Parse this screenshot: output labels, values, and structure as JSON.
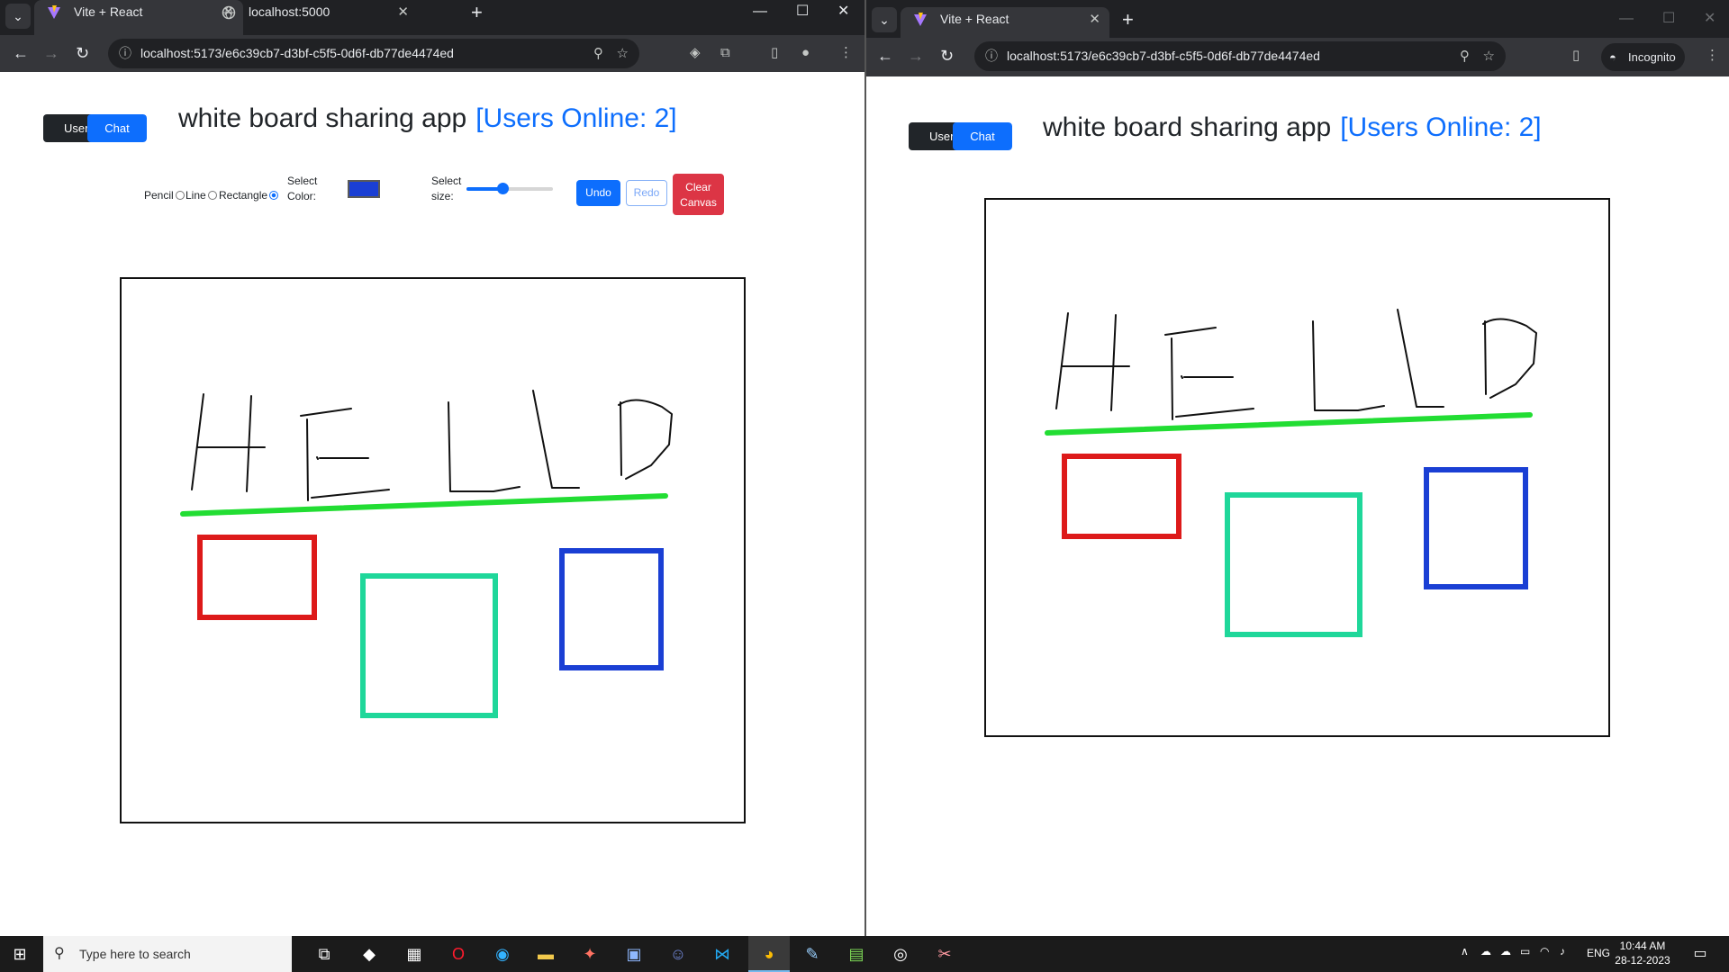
{
  "left_window": {
    "tabs": [
      {
        "title": "Vite + React",
        "active": true
      },
      {
        "title": "localhost:5000",
        "active": false
      }
    ],
    "url": "localhost:5173/e6c39cb7-d3bf-c5f5-0d6f-db77de4474ed",
    "toggle": {
      "user_label": "User",
      "chat_label": "Chat"
    },
    "title": "white board sharing app",
    "users_online": "[Users Online: 2]",
    "tools": {
      "pencil_label": "Pencil",
      "line_label": "Line",
      "rectangle_label": "Rectangle",
      "selected_tool": "rectangle",
      "color_label_1": "Select",
      "color_label_2": "Color:",
      "color_value": "#1a3fd4",
      "size_label_1": "Select",
      "size_label_2": "size:",
      "size_fraction": 0.42,
      "undo_label": "Undo",
      "redo_label": "Redo",
      "clear_label_1": "Clear",
      "clear_label_2": "Canvas"
    }
  },
  "right_window": {
    "tabs": [
      {
        "title": "Vite + React",
        "active": true
      }
    ],
    "url": "localhost:5173/e6c39cb7-d3bf-c5f5-0d6f-db77de4474ed",
    "incognito_label": "Incognito",
    "toggle": {
      "user_label": "User",
      "chat_label": "Chat"
    },
    "title": "white board sharing app",
    "users_online": "[Users Online: 2]"
  },
  "drawing": {
    "strokes_color": "#111111",
    "underline_color": "#22dd33",
    "rects": [
      {
        "color": "#dd1a1a"
      },
      {
        "color": "#1fd79a"
      },
      {
        "color": "#1a3fd4"
      }
    ]
  },
  "taskbar": {
    "search_placeholder": "Type here to search",
    "language": "ENG",
    "time": "10:44 AM",
    "date": "28-12-2023"
  }
}
